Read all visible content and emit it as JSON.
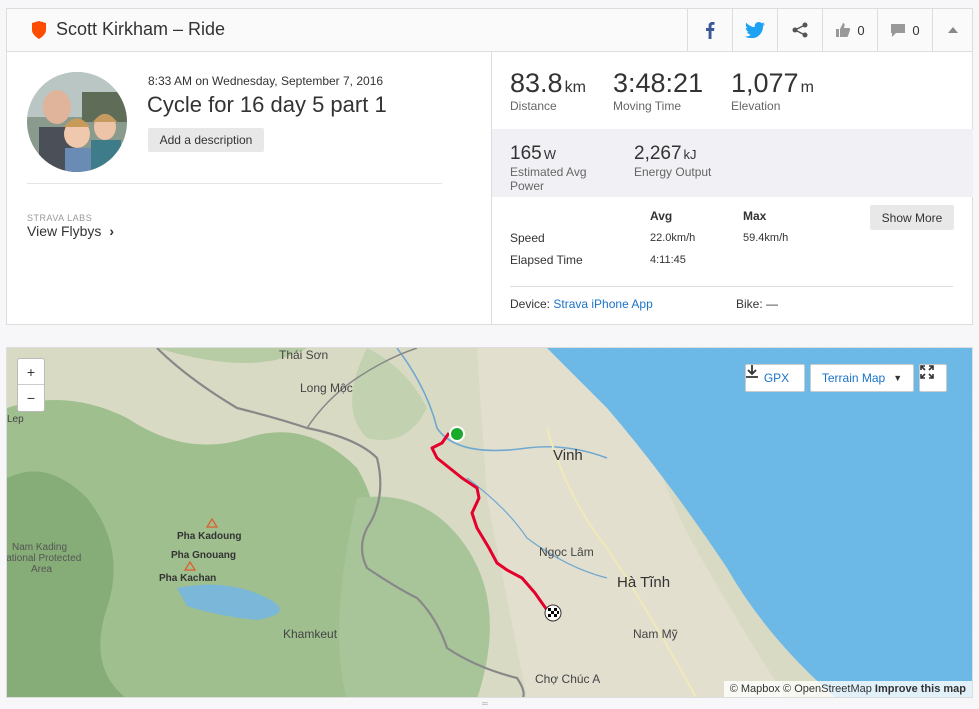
{
  "header": {
    "title": "Scott Kirkham – Ride",
    "kudos_count": "0",
    "comments_count": "0",
    "brand_color": "#fc4c02"
  },
  "activity": {
    "date": "8:33 AM on Wednesday, September 7, 2016",
    "title": "Cycle for 16 day 5 part 1",
    "add_description": "Add a description",
    "labs_label": "STRAVA LABS",
    "flybys_label": "View Flybys"
  },
  "stats": {
    "distance": {
      "value": "83.8",
      "unit": "km",
      "label": "Distance"
    },
    "moving_time": {
      "value": "3:48:21",
      "label": "Moving Time"
    },
    "elevation": {
      "value": "1,077",
      "unit": "m",
      "label": "Elevation"
    },
    "power": {
      "value": "165",
      "unit": "W",
      "label1": "Estimated Avg",
      "label2": "Power"
    },
    "energy": {
      "value": "2,267",
      "unit": "kJ",
      "label": "Energy Output"
    }
  },
  "details": {
    "col_avg": "Avg",
    "col_max": "Max",
    "speed_label": "Speed",
    "speed_avg": "22.0km/h",
    "speed_max": "59.4km/h",
    "elapsed_label": "Elapsed Time",
    "elapsed_avg": "4:11:45",
    "show_more": "Show More",
    "device_label": "Device:",
    "device_value": "Strava iPhone App",
    "bike_label": "Bike:",
    "bike_value": "—"
  },
  "map": {
    "gpx_label": "GPX",
    "terrain_label": "Terrain Map",
    "zoom_in": "+",
    "zoom_out": "−",
    "labels": {
      "thai_son": "Thái Sơn",
      "long_moc": "Long Mộc",
      "lep": "Lep",
      "vinh": "Vinh",
      "pha_kadoung": "Pha Kadoung",
      "pha_gnouang": "Pha Gnouang",
      "pha_kachan": "Pha Kachan",
      "nam_kading_1": "Nam Kading",
      "nam_kading_2": "National Protected",
      "nam_kading_3": "Area",
      "ngoc_lam": "Ngọc Lâm",
      "ha_tinh": "Hà Tĩnh",
      "khamkeut": "Khamkeut",
      "nam_my": "Nam Mỹ",
      "cho_chuc_a": "Chợ Chúc A"
    },
    "attribution": "© Mapbox © OpenStreetMap",
    "improve": "Improve this map",
    "route_color": "#e4002b",
    "start_color": "#1aab2c"
  }
}
